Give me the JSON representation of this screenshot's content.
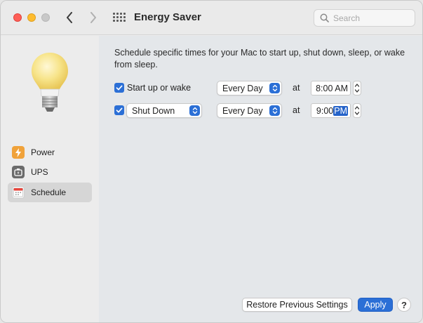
{
  "window": {
    "title": "Energy Saver",
    "search_placeholder": "Search"
  },
  "sidebar": {
    "items": [
      {
        "label": "Power",
        "icon": "bolt-icon",
        "color": "#f0a23a",
        "selected": false
      },
      {
        "label": "UPS",
        "icon": "ups-battery-icon",
        "color": "#6b6b6b",
        "selected": false
      },
      {
        "label": "Schedule",
        "icon": "calendar-icon",
        "color": "#e8e8e8",
        "selected": true
      }
    ]
  },
  "schedule": {
    "description": "Schedule specific times for your Mac to start up, shut down, sleep, or wake from sleep.",
    "rows": [
      {
        "checked": true,
        "action": "Start up or wake",
        "frequency": "Every Day",
        "at_label": "at",
        "time": "8:00",
        "ampm": "AM"
      },
      {
        "checked": true,
        "action": "Shut Down",
        "frequency": "Every Day",
        "at_label": "at",
        "time": "9:00",
        "ampm": "PM"
      }
    ]
  },
  "footer": {
    "restore_label": "Restore Previous Settings",
    "apply_label": "Apply",
    "help_label": "?"
  },
  "colors": {
    "accent": "#2b6fd6",
    "close": "#fe5f57",
    "minimize": "#febc2e"
  }
}
